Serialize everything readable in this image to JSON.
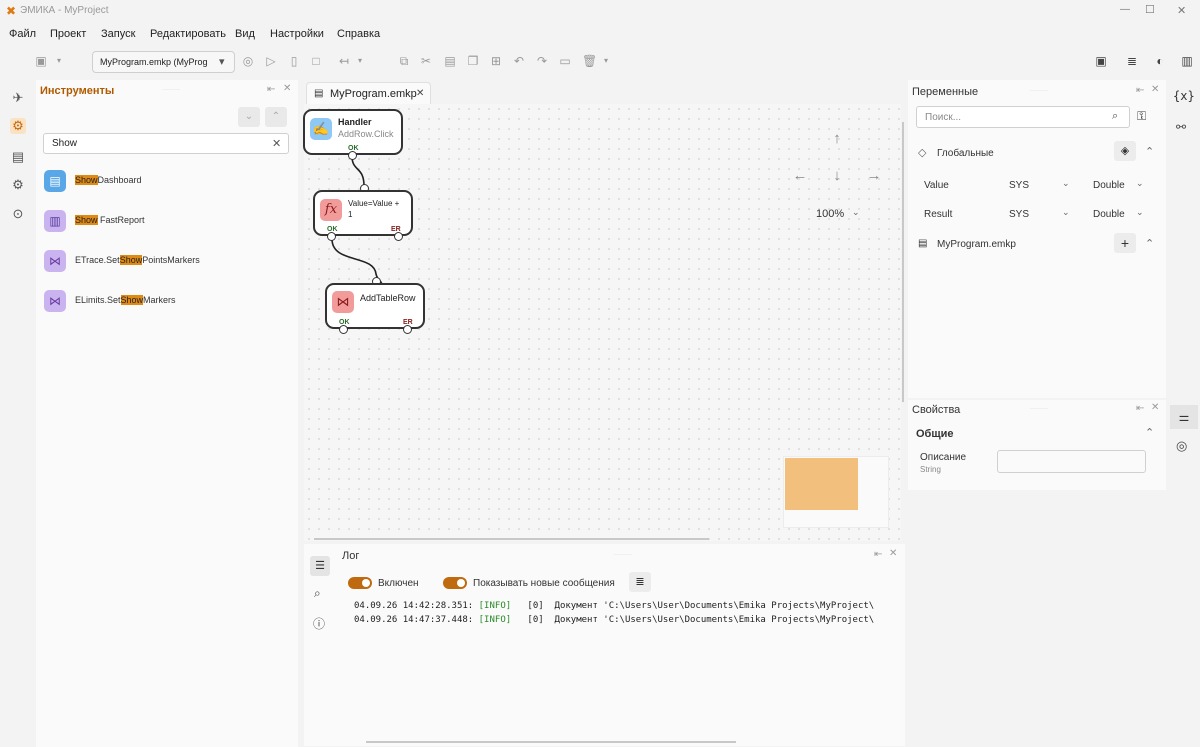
{
  "window": {
    "title": "ЭМИКА - MyProject",
    "minimize": "—",
    "maximize": "☐",
    "close": "✕"
  },
  "menu": [
    "Файл",
    "Проект",
    "Запуск",
    "Редактировать",
    "Вид",
    "Настройки",
    "Справка"
  ],
  "toolbar": {
    "project_select": "MyProgram.emkp (MyProgra",
    "select_chevron": "▾"
  },
  "tools_panel": {
    "title": "Инструменты",
    "search_value": "Show",
    "items": [
      {
        "pre": "",
        "match": "Show",
        "post": "Dashboard",
        "color": "#5aa7e8"
      },
      {
        "pre": "",
        "match": "Show",
        "post": " FastReport",
        "color": "#a88ce0"
      },
      {
        "pre": "ETrace.Set",
        "match": "Show",
        "post": "PointsMarkers",
        "color": "#b39be6"
      },
      {
        "pre": "ELimits.Set",
        "match": "Show",
        "post": "Markers",
        "color": "#b39be6"
      }
    ]
  },
  "editor": {
    "tab_label": "MyProgram.emkp",
    "zoom": "100%",
    "nodes": {
      "handler": {
        "title": "Handler",
        "subtitle": "AddRow.Click",
        "ok": "OK",
        "icon": "handler-icon"
      },
      "func": {
        "text": "Value=Value +",
        "text2": "1",
        "ok": "OK",
        "er": "ER",
        "icon": "fx-icon"
      },
      "addrow": {
        "title": "AddTableRow",
        "ok": "OK",
        "er": "ER",
        "icon": "butterfly-icon"
      }
    }
  },
  "variables_panel": {
    "title": "Переменные",
    "search_placeholder": "Поиск...",
    "globals_label": "Глобальные",
    "rows": [
      {
        "name": "Value",
        "scope": "SYS",
        "type": "Double"
      },
      {
        "name": "Result",
        "scope": "SYS",
        "type": "Double"
      }
    ],
    "file_label": "MyProgram.emkp"
  },
  "properties_panel": {
    "title": "Свойства",
    "section": "Общие",
    "field_label": "Описание",
    "field_type": "String",
    "field_value": ""
  },
  "log_panel": {
    "title": "Лог",
    "toggle1": "Включен",
    "toggle2": "Показывать новые сообщения",
    "lines": [
      {
        "ts": "04.09.26 14:42:28.351:",
        "level": "[INFO]",
        "code": "[0]",
        "msg": "Документ 'C:\\Users\\User\\Documents\\Emika Projects\\MyProject\\"
      },
      {
        "ts": "04.09.26 14:47:37.448:",
        "level": "[INFO]",
        "code": "[0]",
        "msg": "Документ 'C:\\Users\\User\\Documents\\Emika Projects\\MyProject\\"
      }
    ]
  },
  "colors": {
    "accent": "#c06a10",
    "highlight": "#e08a16",
    "info_green": "#2a8a2a"
  }
}
